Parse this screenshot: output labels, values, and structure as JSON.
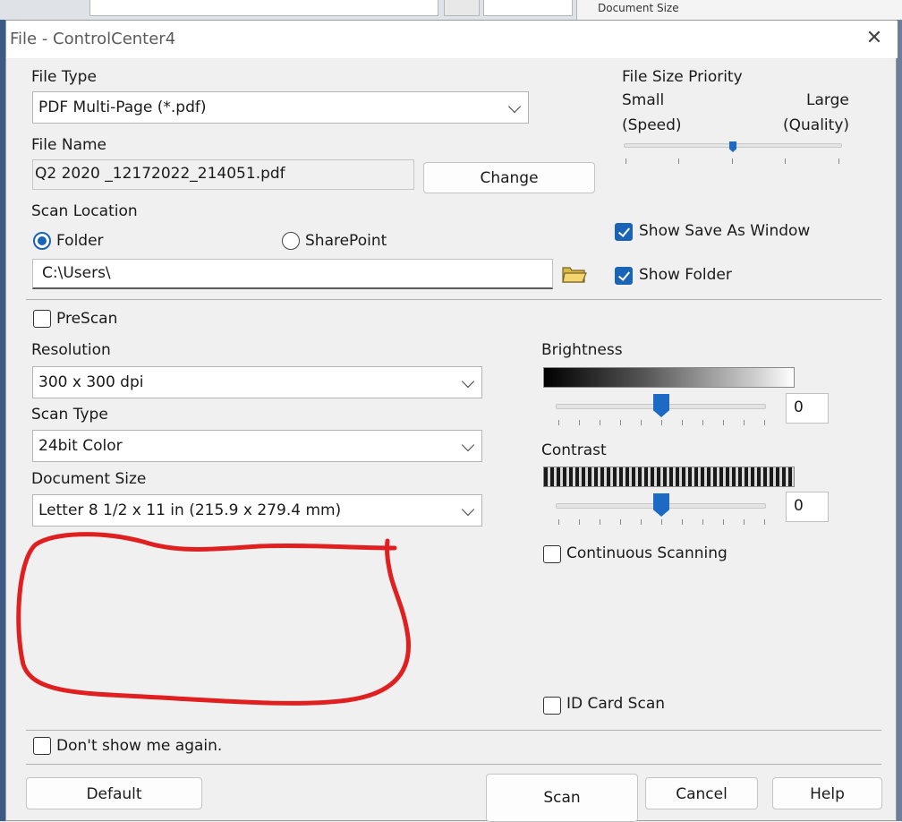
{
  "background": {
    "caption": "Document Size"
  },
  "window": {
    "title": "File - ControlCenter4",
    "close_glyph": "✕"
  },
  "file_type": {
    "label": "File Type",
    "value": "PDF Multi-Page (*.pdf)"
  },
  "file_size_priority": {
    "label": "File Size Priority",
    "small": "Small",
    "speed": "(Speed)",
    "large": "Large",
    "quality": "(Quality)",
    "level_fraction": 0.5
  },
  "file_name": {
    "label": "File Name",
    "value": "Q2 2020 _12172022_214051.pdf",
    "change_label": "Change"
  },
  "scan_location": {
    "label": "Scan Location",
    "folder_label": "Folder",
    "folder_selected": true,
    "sharepoint_label": "SharePoint",
    "sharepoint_selected": false,
    "path": "C:\\Users\\"
  },
  "show_save_as": {
    "label": "Show Save As Window",
    "checked": true
  },
  "show_folder": {
    "label": "Show Folder",
    "checked": true
  },
  "prescan": {
    "label": "PreScan",
    "checked": false
  },
  "resolution": {
    "label": "Resolution",
    "value": "300 x 300 dpi"
  },
  "scan_type": {
    "label": "Scan Type",
    "value": "24bit Color"
  },
  "document_size": {
    "label": "Document Size",
    "value": "Letter 8 1/2 x 11 in (215.9 x 279.4 mm)"
  },
  "brightness": {
    "label": "Brightness",
    "value": "0"
  },
  "contrast": {
    "label": "Contrast",
    "value": "0"
  },
  "continuous_scanning": {
    "label": "Continuous Scanning",
    "checked": false
  },
  "id_card_scan": {
    "label": "ID Card Scan",
    "checked": false
  },
  "dont_show": {
    "label": "Don't show me again.",
    "checked": false
  },
  "buttons": {
    "default": "Default",
    "scan": "Scan",
    "cancel": "Cancel",
    "help": "Help"
  },
  "colors": {
    "accent": "#1a64b8",
    "annotation": "#e02020"
  }
}
